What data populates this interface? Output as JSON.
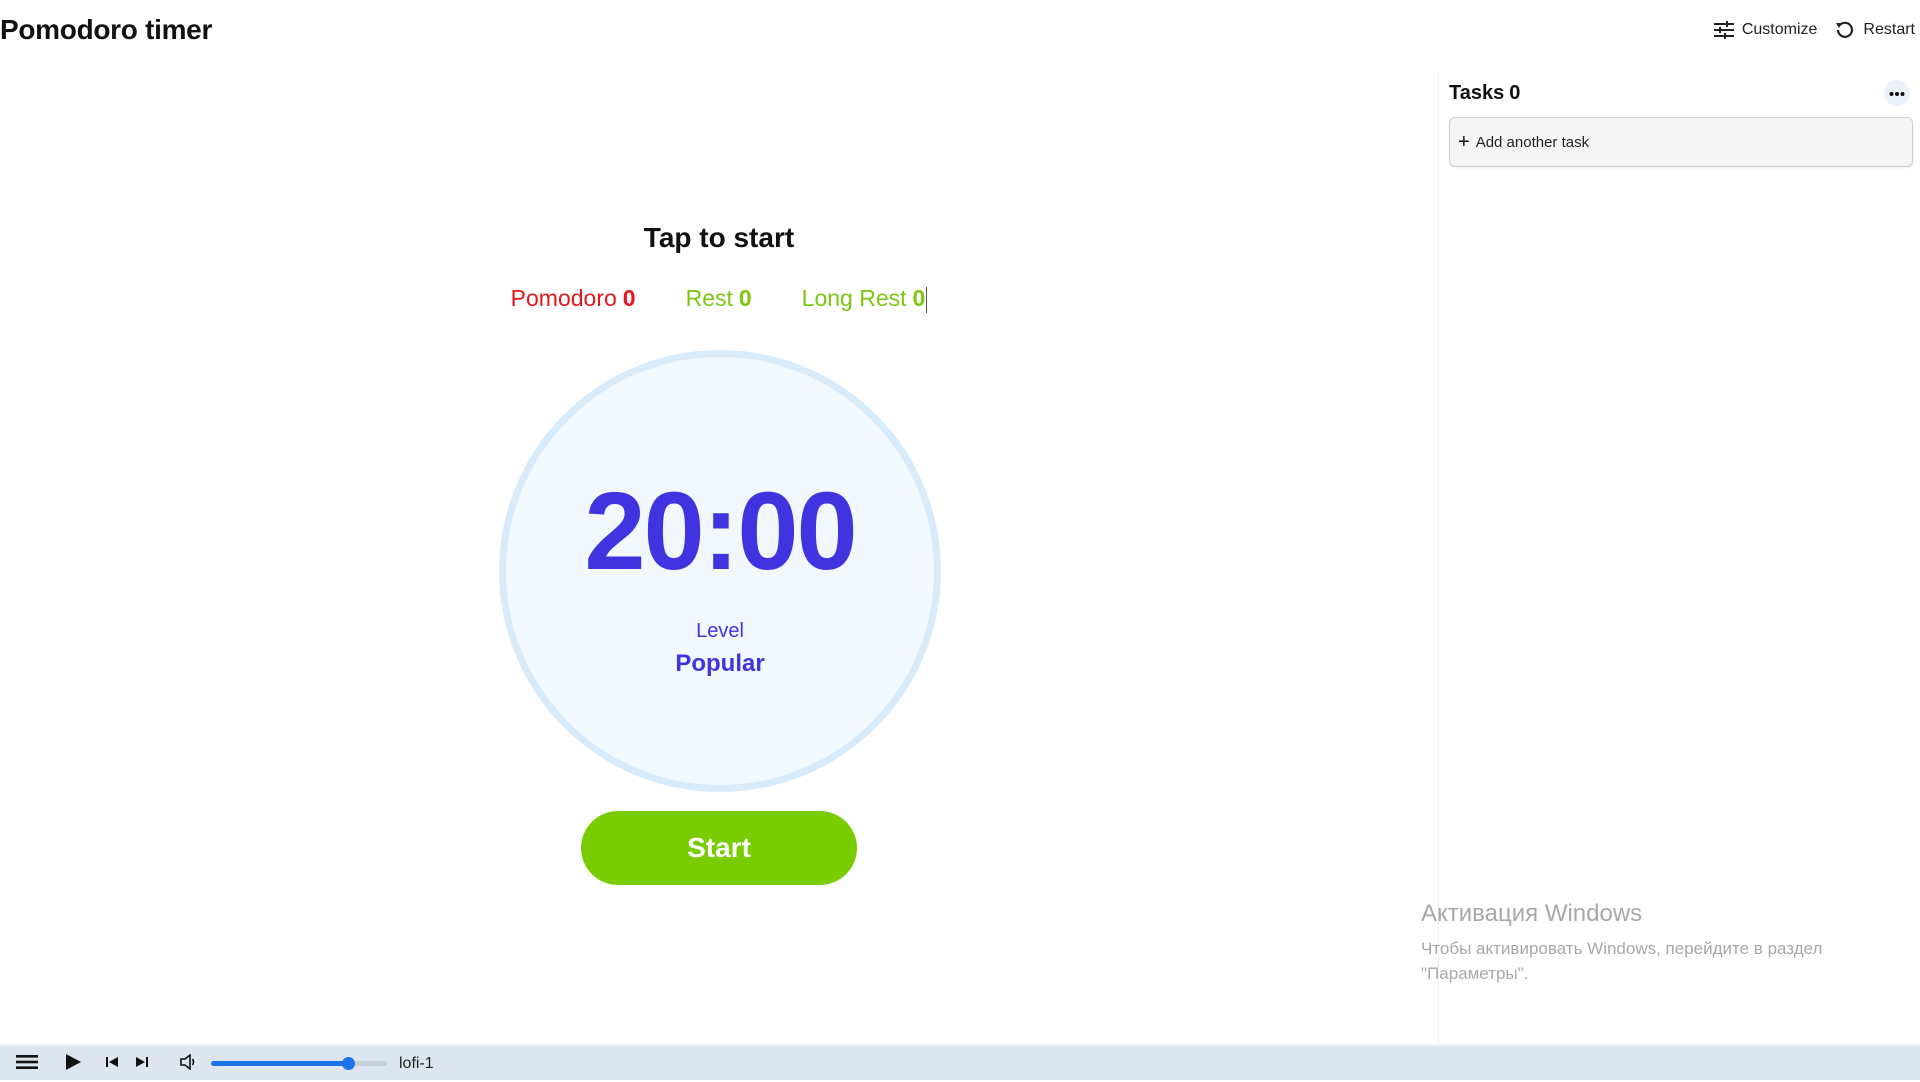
{
  "header": {
    "title": "Pomodoro timer",
    "customize_label": "Customize",
    "restart_label": "Restart"
  },
  "tasks": {
    "title": "Tasks",
    "count": "0",
    "add_label": "Add another task",
    "more_icon": "more-horizontal-icon"
  },
  "main": {
    "prompt": "Tap to start",
    "counters": {
      "pomodoro_label": "Pomodoro",
      "pomodoro_count": "0",
      "rest_label": "Rest",
      "rest_count": "0",
      "long_rest_label": "Long Rest",
      "long_rest_count": "0"
    },
    "timer": {
      "time": "20:00",
      "level_label": "Level",
      "level_value": "Popular"
    },
    "start_label": "Start"
  },
  "watermark": {
    "title": "Активация Windows",
    "line1": "Чтобы активировать Windows, перейдите в раздел",
    "line2": "\"Параметры\"."
  },
  "player": {
    "track": "lofi-1",
    "volume": 0.78
  },
  "colors": {
    "timer_text": "#3f34e0",
    "pomodoro": "#e8151b",
    "rest": "#7cc611",
    "start_button": "#79cc00",
    "timer_bg": "#f1f8fe",
    "timer_ring": "#d8ebfa",
    "player_bg": "#dde6ee",
    "volume_accent": "#1a73e8"
  }
}
